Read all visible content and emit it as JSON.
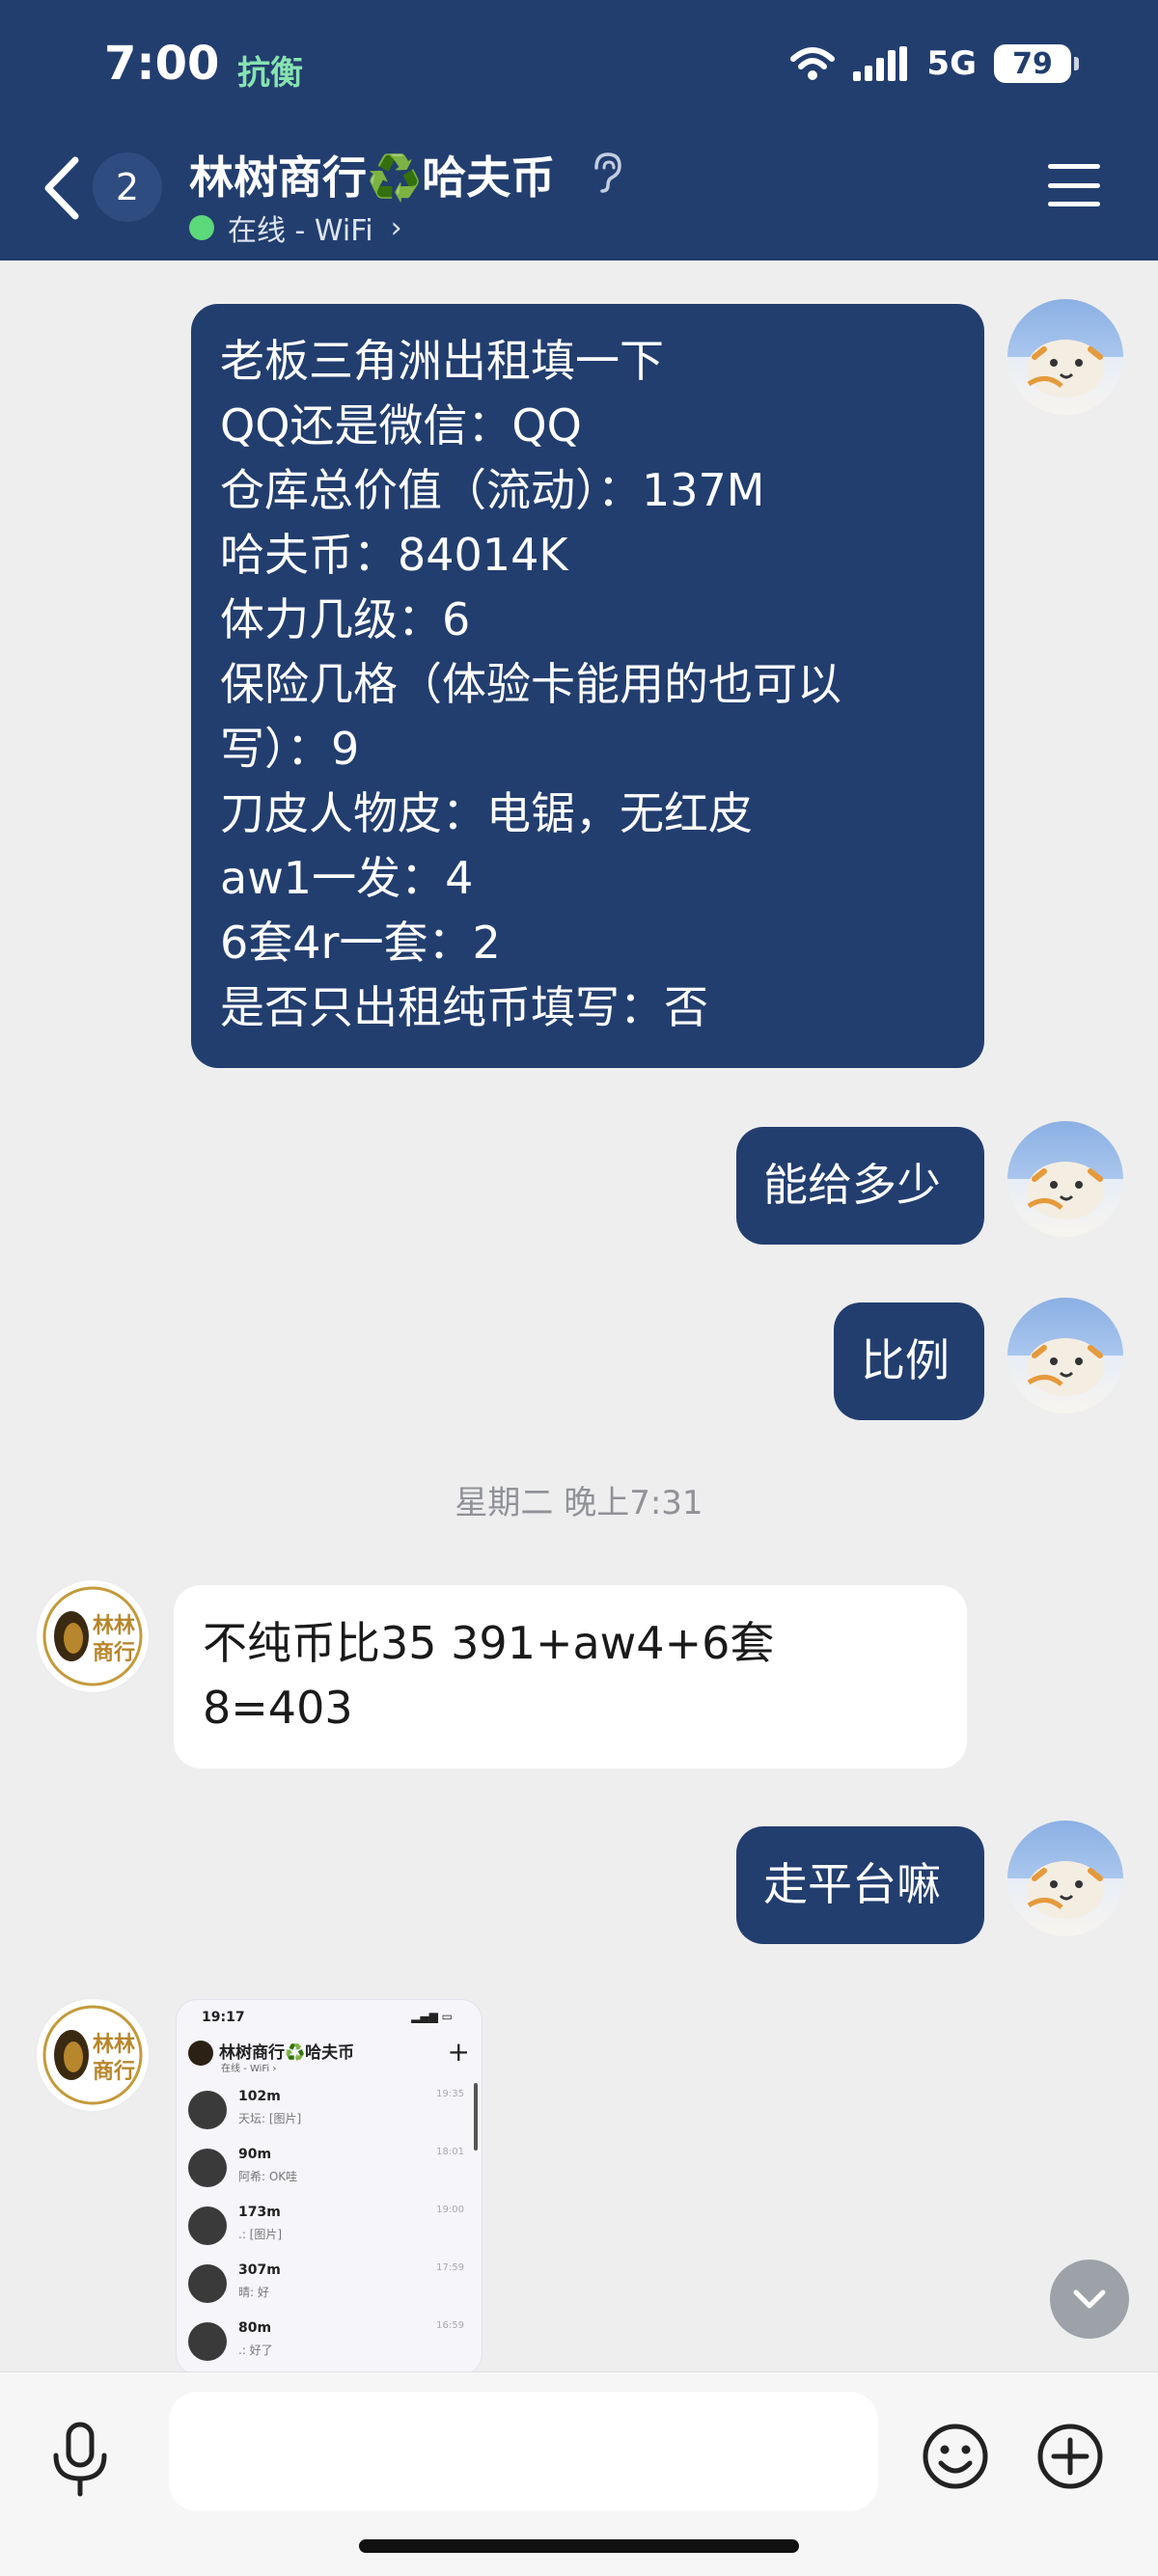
{
  "status_bar": {
    "time": "7:00",
    "carrier_tag": "抗衡",
    "network": "5G",
    "battery": "79"
  },
  "header": {
    "unread_count": "2",
    "title": "林树商行♻️哈夫币",
    "presence": "在线 - WiFi",
    "presence_color": "#5cd97a",
    "accent": "#223e6f"
  },
  "messages": [
    {
      "direction": "out",
      "lines": [
        "老板三角洲出租填一下",
        "QQ还是微信：QQ",
        "仓库总价值（流动）：137M",
        "哈夫币：84014K",
        "体力几级：6",
        "保险几格（体验卡能用的也可以",
        "写）：9",
        "刀皮人物皮：电锯，无红皮",
        "aw1一发：4",
        "6套4r一套：2",
        "是否只出租纯币填写：否"
      ]
    },
    {
      "direction": "out",
      "lines": [
        "能给多少"
      ]
    },
    {
      "direction": "out",
      "lines": [
        "比例"
      ]
    },
    {
      "direction": "in",
      "lines": [
        "不纯币比35 391+aw4+6套",
        "8=403"
      ]
    },
    {
      "direction": "out",
      "lines": [
        "走平台嘛"
      ]
    }
  ],
  "timestamp": "星期二 晚上7:31",
  "avatar_lion_text": [
    "林林",
    "商行"
  ],
  "shared_image": {
    "time": "19:17",
    "title": "林树商行♻️哈夫币",
    "subtitle": "在线 - WiFi ›",
    "rows": [
      {
        "title": "102m",
        "preview": "天坛: [图片]",
        "time": "19:35"
      },
      {
        "title": "90m",
        "preview": "阿希: OK哇",
        "time": "18:01"
      },
      {
        "title": "173m",
        "preview": ".: [图片]",
        "time": "19:00"
      },
      {
        "title": "307m",
        "preview": "晴: 好",
        "time": "17:59"
      },
      {
        "title": "80m",
        "preview": ".: 好了",
        "time": "16:59"
      }
    ]
  },
  "input": {
    "placeholder": ""
  }
}
